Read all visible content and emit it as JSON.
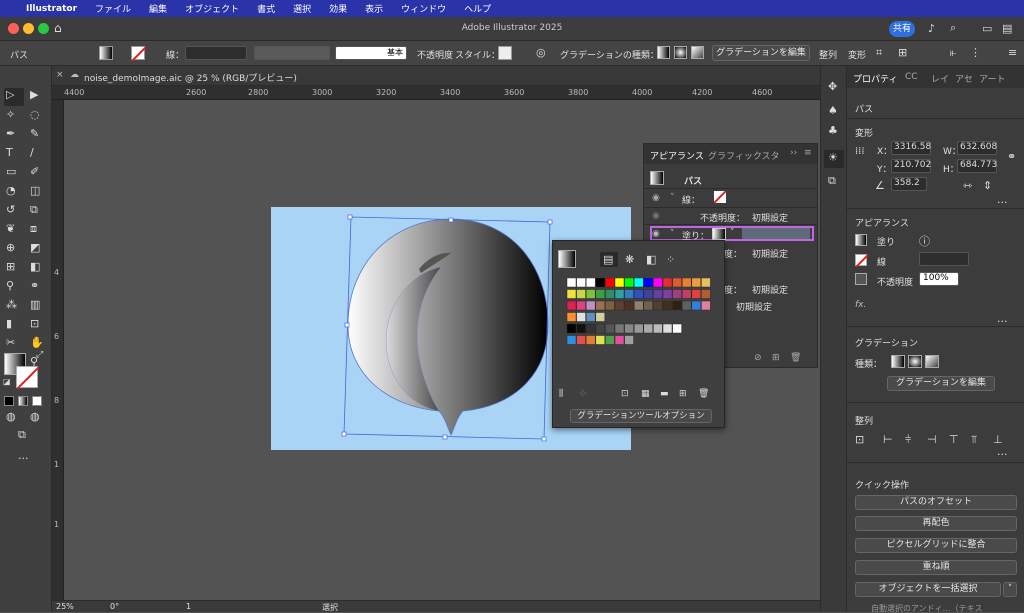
{
  "menubar": {
    "app": "Illustrator",
    "items": [
      "ファイル",
      "編集",
      "オブジェクト",
      "書式",
      "選択",
      "効果",
      "表示",
      "ウィンドウ",
      "ヘルプ"
    ]
  },
  "window": {
    "title": "Adobe Illustrator 2025",
    "share": "共有"
  },
  "control": {
    "path": "パス",
    "stroke": "線：",
    "stroke_style": "基本",
    "opacity": "不透明度",
    "style": "スタイル：",
    "grad_type": "グラデーションの種類：",
    "edit_grad": "グラデーションを編集",
    "align": "整列",
    "transform": "変形"
  },
  "doc_tab": {
    "name": "noise_demoImage.aic @ 25 % (RGB/プレビュー)"
  },
  "ruler": {
    "h": [
      "4400",
      "2600",
      "2800",
      "3000",
      "3200",
      "3400",
      "3600",
      "3800",
      "4000",
      "4200",
      "4400",
      "4600"
    ],
    "v": [
      "2",
      "4",
      "6",
      "8",
      "1",
      "1"
    ]
  },
  "status": {
    "zoom": "25%",
    "angle": "0°",
    "artboard": "1",
    "tool": "選択"
  },
  "appearance": {
    "tab1": "アピアランス",
    "tab2": "グラフィックスタ",
    "path": "パス",
    "stroke": "線：",
    "opacity1": "不透明度：",
    "default1": "初期設定",
    "fill": "塗り：",
    "opacity2": "度：",
    "default2": "初期設定",
    "opacity3": "度：",
    "default3": "初期設定",
    "default4": "初期設定"
  },
  "swatch_popup": {
    "option_btn": "グラデーションツールオプション"
  },
  "props": {
    "tabs": [
      "プロパティ",
      "CC",
      "レイ",
      "アセ",
      "アート"
    ],
    "path": "パス",
    "transform": "変形",
    "x_label": "X：",
    "x": "3316.58",
    "y_label": "Y：",
    "y": "210.702",
    "w_label": "W：",
    "w": "632.608",
    "h_label": "H：",
    "h": "684.773",
    "angle": "358.2",
    "appearance": "アピアランス",
    "fill": "塗り",
    "stroke": "線",
    "opacity_label": "不透明度",
    "opacity": "100%",
    "fx": "fx.",
    "gradient": "グラデーション",
    "grad_type": "種類：",
    "edit_grad": "グラデーションを編集",
    "align": "整列",
    "quick": "クイック操作",
    "q1": "パスのオフセット",
    "q2": "再配色",
    "q3": "ピクセルグリッドに整合",
    "q4": "重ね順",
    "q5": "オブジェクトを一括選択",
    "q6": "自動選択のアンドィ…（テキス"
  }
}
